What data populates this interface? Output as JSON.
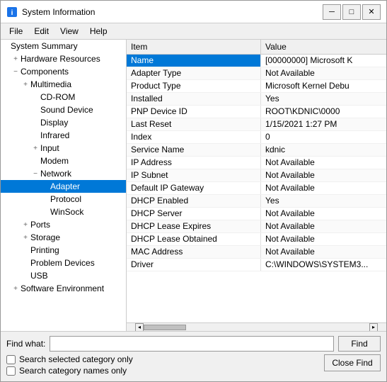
{
  "window": {
    "title": "System Information",
    "icon": "info-icon"
  },
  "titlebar": {
    "minimize_label": "─",
    "maximize_label": "□",
    "close_label": "✕"
  },
  "menu": {
    "items": [
      {
        "label": "File"
      },
      {
        "label": "Edit"
      },
      {
        "label": "View"
      },
      {
        "label": "Help"
      }
    ]
  },
  "tree": {
    "header": "System Summary",
    "items": [
      {
        "id": "system-summary",
        "label": "System Summary",
        "indent": 0,
        "expander": ""
      },
      {
        "id": "hardware-resources",
        "label": "Hardware Resources",
        "indent": 1,
        "expander": "+"
      },
      {
        "id": "components",
        "label": "Components",
        "indent": 1,
        "expander": "−"
      },
      {
        "id": "multimedia",
        "label": "Multimedia",
        "indent": 2,
        "expander": "+"
      },
      {
        "id": "cd-rom",
        "label": "CD-ROM",
        "indent": 3,
        "expander": ""
      },
      {
        "id": "sound-device",
        "label": "Sound Device",
        "indent": 3,
        "expander": ""
      },
      {
        "id": "display",
        "label": "Display",
        "indent": 3,
        "expander": ""
      },
      {
        "id": "infrared",
        "label": "Infrared",
        "indent": 3,
        "expander": ""
      },
      {
        "id": "input",
        "label": "Input",
        "indent": 3,
        "expander": "+"
      },
      {
        "id": "modem",
        "label": "Modem",
        "indent": 3,
        "expander": ""
      },
      {
        "id": "network",
        "label": "Network",
        "indent": 3,
        "expander": "−"
      },
      {
        "id": "adapter",
        "label": "Adapter",
        "indent": 4,
        "expander": "",
        "selected": true
      },
      {
        "id": "protocol",
        "label": "Protocol",
        "indent": 4,
        "expander": ""
      },
      {
        "id": "winsock",
        "label": "WinSock",
        "indent": 4,
        "expander": ""
      },
      {
        "id": "ports",
        "label": "Ports",
        "indent": 2,
        "expander": "+"
      },
      {
        "id": "storage",
        "label": "Storage",
        "indent": 2,
        "expander": "+"
      },
      {
        "id": "printing",
        "label": "Printing",
        "indent": 2,
        "expander": ""
      },
      {
        "id": "problem-devices",
        "label": "Problem Devices",
        "indent": 2,
        "expander": ""
      },
      {
        "id": "usb",
        "label": "USB",
        "indent": 2,
        "expander": ""
      },
      {
        "id": "software-environment",
        "label": "Software Environment",
        "indent": 1,
        "expander": "+"
      }
    ]
  },
  "table": {
    "col_item": "Item",
    "col_value": "Value",
    "rows": [
      {
        "item": "Name",
        "value": "[00000000] Microsoft K",
        "highlighted": true
      },
      {
        "item": "Adapter Type",
        "value": "Not Available",
        "highlighted": false
      },
      {
        "item": "Product Type",
        "value": "Microsoft Kernel Debu",
        "highlighted": false
      },
      {
        "item": "Installed",
        "value": "Yes",
        "highlighted": false
      },
      {
        "item": "PNP Device ID",
        "value": "ROOT\\KDNIC\\0000",
        "highlighted": false
      },
      {
        "item": "Last Reset",
        "value": "1/15/2021 1:27 PM",
        "highlighted": false
      },
      {
        "item": "Index",
        "value": "0",
        "highlighted": false
      },
      {
        "item": "Service Name",
        "value": "kdnic",
        "highlighted": false
      },
      {
        "item": "IP Address",
        "value": "Not Available",
        "highlighted": false
      },
      {
        "item": "IP Subnet",
        "value": "Not Available",
        "highlighted": false
      },
      {
        "item": "Default IP Gateway",
        "value": "Not Available",
        "highlighted": false
      },
      {
        "item": "DHCP Enabled",
        "value": "Yes",
        "highlighted": false
      },
      {
        "item": "DHCP Server",
        "value": "Not Available",
        "highlighted": false
      },
      {
        "item": "DHCP Lease Expires",
        "value": "Not Available",
        "highlighted": false
      },
      {
        "item": "DHCP Lease Obtained",
        "value": "Not Available",
        "highlighted": false
      },
      {
        "item": "MAC Address",
        "value": "Not Available",
        "highlighted": false
      },
      {
        "item": "Driver",
        "value": "C:\\WINDOWS\\SYSTEM3...",
        "highlighted": false
      }
    ]
  },
  "find": {
    "label": "Find what:",
    "placeholder": "",
    "find_button": "Find",
    "checkbox1": "Search selected category only",
    "checkbox2": "Search category names only",
    "close_find_button": "Close Find"
  }
}
